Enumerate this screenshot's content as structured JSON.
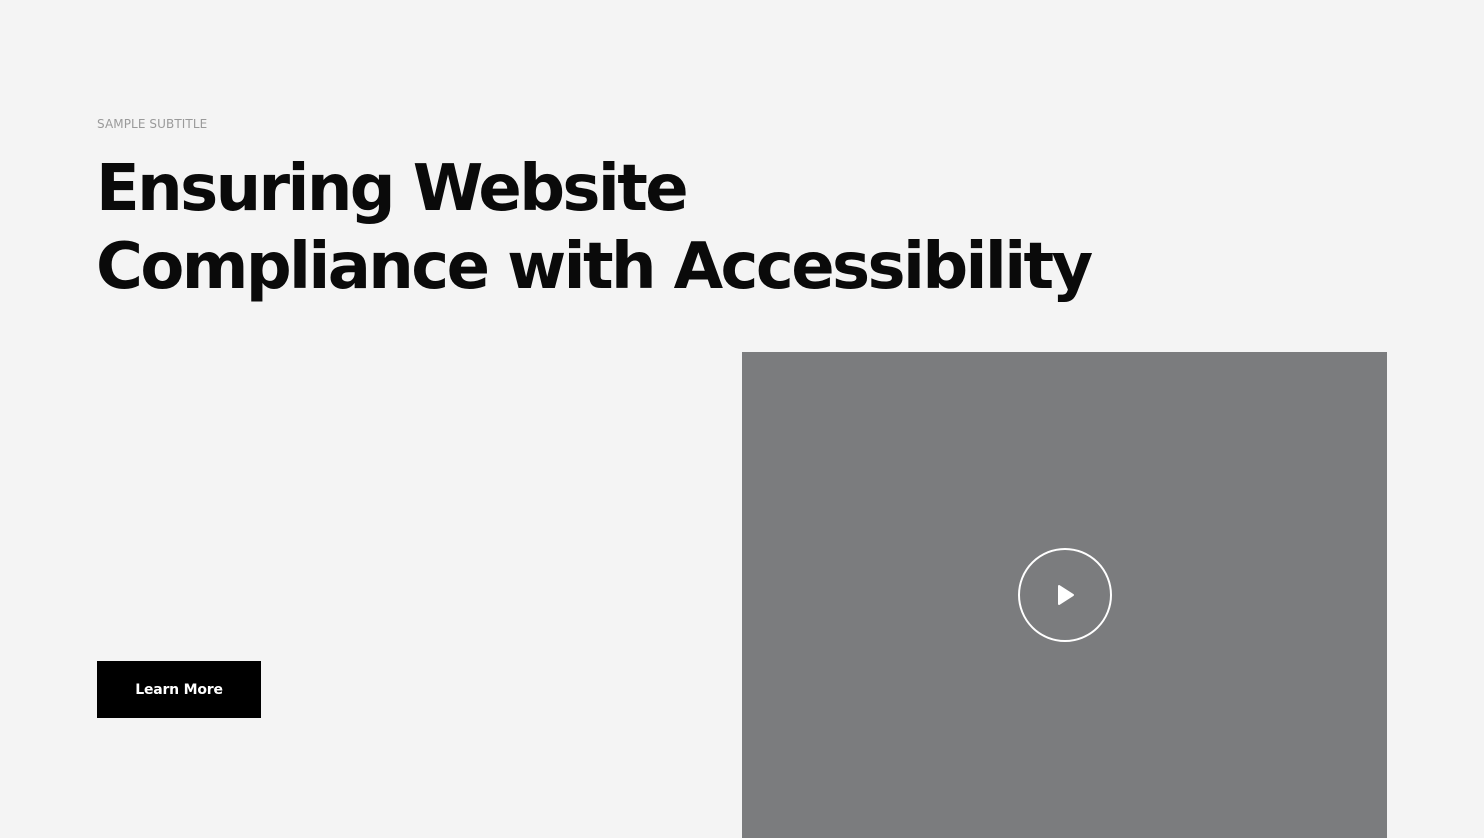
{
  "hero": {
    "subtitle": "SAMPLE SUBTITLE",
    "headline": "Ensuring Website Compliance with Accessibility",
    "cta_label": "Learn More"
  },
  "video": {
    "play_icon": "play-icon",
    "background_color": "#7b7c7e"
  },
  "colors": {
    "page_background": "#f4f4f4",
    "headline": "#0a0a0a",
    "subtitle": "#9a9a9a",
    "button_background": "#000000",
    "button_text": "#ffffff"
  }
}
